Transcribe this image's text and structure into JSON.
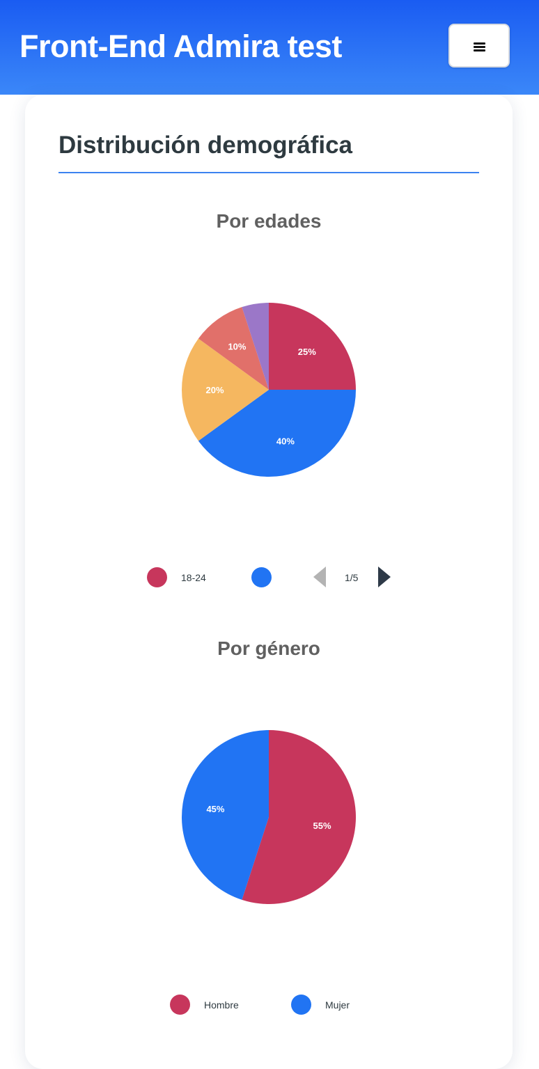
{
  "header": {
    "title": "Front-End Admira test",
    "menu_icon": "hamburger-icon",
    "background": "#1a5cf2"
  },
  "card": {
    "title": "Distribución demográfica",
    "accent": "#3b82f0"
  },
  "chart_data": [
    {
      "type": "pie",
      "title": "Por edades",
      "categories": [
        "18-24",
        "",
        "",
        "",
        ""
      ],
      "values": [
        25,
        40,
        20,
        10,
        5
      ],
      "labels": [
        "25%",
        "40%",
        "20%",
        "10%",
        ""
      ],
      "colors": [
        "#c7365c",
        "#2174f3",
        "#f5b760",
        "#e1706a",
        "#9b77c8"
      ],
      "legend": {
        "placement": "bottom",
        "visible_entries": [
          "18-24",
          ""
        ],
        "page": "1/5"
      }
    },
    {
      "type": "pie",
      "title": "Por género",
      "categories": [
        "Hombre",
        "Mujer"
      ],
      "values": [
        55,
        45
      ],
      "labels": [
        "55%",
        "45%"
      ],
      "colors": [
        "#c7365c",
        "#2174f3"
      ],
      "legend": {
        "placement": "bottom",
        "visible_entries": [
          "Hombre",
          "Mujer"
        ]
      }
    }
  ]
}
